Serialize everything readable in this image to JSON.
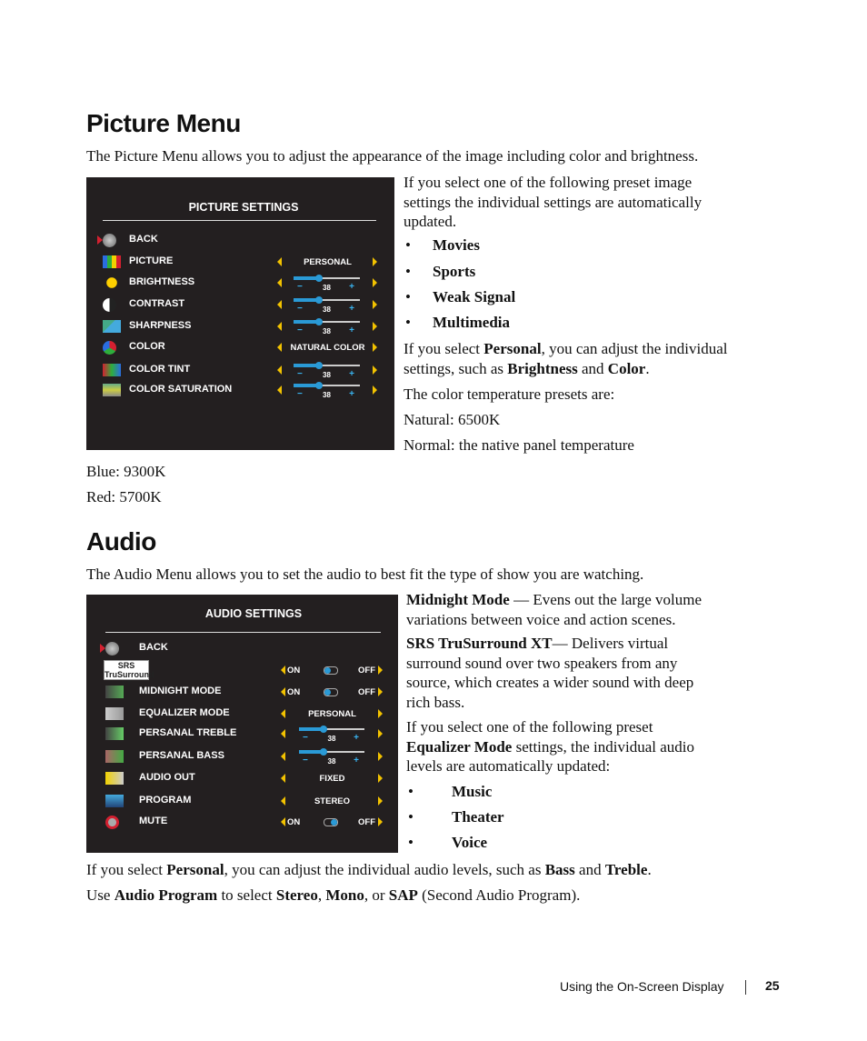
{
  "picture_section": {
    "title": "Picture Menu",
    "intro": "The Picture Menu allows you to adjust the appearance of the image including color and brightness.",
    "osd": {
      "title": "PICTURE SETTINGS",
      "rows": [
        {
          "label": "BACK",
          "icon": "back-icon",
          "selected": true
        },
        {
          "label": "PICTURE",
          "icon": "picture-icon",
          "control": "select",
          "value": "PERSONAL"
        },
        {
          "label": "BRIGHTNESS",
          "icon": "brightness-icon",
          "control": "slider",
          "value": 38
        },
        {
          "label": "CONTRAST",
          "icon": "contrast-icon",
          "control": "slider",
          "value": 38
        },
        {
          "label": "SHARPNESS",
          "icon": "sharpness-icon",
          "control": "slider",
          "value": 38
        },
        {
          "label": "COLOR",
          "icon": "color-icon",
          "control": "select",
          "value": "NATURAL COLOR"
        },
        {
          "label": "COLOR TINT",
          "icon": "color-tint-icon",
          "control": "slider",
          "value": 38
        },
        {
          "label": "COLOR SATURATION",
          "icon": "color-saturation-icon",
          "control": "slider",
          "value": 38
        }
      ]
    },
    "preset_intro": "If you select one of the following preset image settings the individual settings are automatically updated.",
    "presets": [
      "Movies",
      "Sports",
      "Weak Signal",
      "Multimedia"
    ],
    "personal_pre": "If you select ",
    "personal_word": "Personal",
    "personal_mid": ", you can adjust the individual settings, such as ",
    "brightness_word": "Brightness",
    "and": " and ",
    "color_word": "Color",
    "period": ".",
    "temp_intro": "The color temperature presets are:",
    "temps": [
      "Natural: 6500K",
      "Normal: the native panel temperature",
      "Blue: 9300K",
      "Red: 5700K"
    ]
  },
  "audio_section": {
    "title": "Audio",
    "intro": "The Audio Menu allows you to set the audio to best fit the type of show you are watching.",
    "osd": {
      "title": "AUDIO SETTINGS",
      "srs_logo": "SRS TruSurround XT",
      "rows": [
        {
          "label": "BACK",
          "icon": "back-icon",
          "selected": true
        },
        {
          "label": "",
          "icon": "srs-logo",
          "control": "toggle",
          "on": "ON",
          "off": "OFF",
          "state": "on"
        },
        {
          "label": "MIDNIGHT MODE",
          "icon": "midnight-mode-icon",
          "control": "toggle",
          "on": "ON",
          "off": "OFF",
          "state": "on"
        },
        {
          "label": "EQUALIZER MODE",
          "icon": "speaker-icon",
          "control": "select",
          "value": "PERSONAL"
        },
        {
          "label": "PERSANAL TREBLE",
          "icon": "treble-icon",
          "control": "slider",
          "value": 38
        },
        {
          "label": "PERSANAL BASS",
          "icon": "bass-icon",
          "control": "slider",
          "value": 38
        },
        {
          "label": "AUDIO OUT",
          "icon": "audio-out-icon",
          "control": "select",
          "value": "FIXED"
        },
        {
          "label": "PROGRAM",
          "icon": "program-icon",
          "control": "select",
          "value": "STEREO"
        },
        {
          "label": "MUTE",
          "icon": "mute-icon",
          "control": "toggle",
          "on": "ON",
          "off": "OFF",
          "state": "off"
        }
      ]
    },
    "midnight_term": "Midnight Mode",
    "midnight_desc": " — Evens out the large volume variations between voice and action scenes.",
    "srs_term": "SRS TruSurround XT",
    "srs_desc": "— Delivers virtual surround sound over two speakers from any source, which creates a wider sound with deep rich bass.",
    "eq_pre": "If you select one of the following preset ",
    "eq_term": "Equalizer Mode",
    "eq_post": " settings, the individual audio levels are automatically updated:",
    "presets": [
      "Music",
      "Theater",
      "Voice"
    ],
    "personal_pre": "If you select ",
    "personal_word": "Personal",
    "personal_mid": ", you can adjust the individual audio levels, such as ",
    "bass_word": "Bass",
    "and": " and ",
    "treble_word": "Treble",
    "period": ".",
    "use": "Use ",
    "program_term": "Audio Program",
    "to_select": " to select ",
    "stereo": "Stereo",
    "comma": ", ",
    "mono": "Mono",
    "or": ", or ",
    "sap": "SAP",
    "sap_desc": " (Second Audio Program)."
  },
  "footer": {
    "section": "Using the On-Screen Display",
    "page": "25"
  }
}
